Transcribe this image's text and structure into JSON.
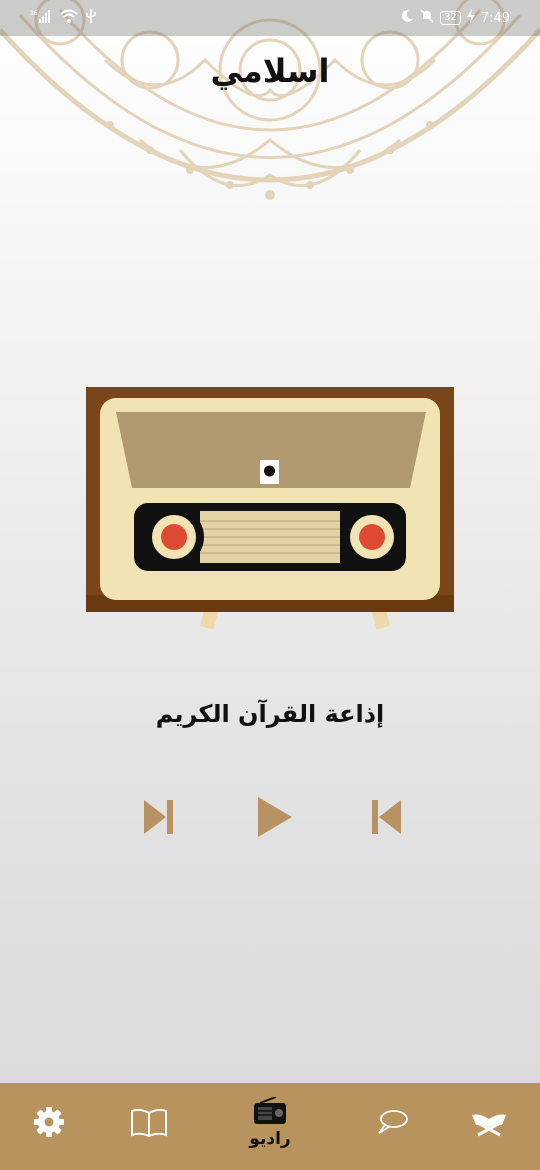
{
  "status_bar": {
    "network": "36",
    "battery": "32",
    "time": "7:49"
  },
  "app": {
    "title": "اسلامي"
  },
  "player": {
    "station_name": "إذاعة القرآن الكريم",
    "controls": [
      "next-icon",
      "play-icon",
      "previous-icon"
    ]
  },
  "bottom_nav": {
    "active_label": "راديو",
    "items": [
      "settings-icon",
      "book-icon",
      "radio-icon",
      "chat-icon",
      "quran-icon"
    ]
  },
  "colors": {
    "accent": "#b8935e",
    "control": "#b89262",
    "ornament": "#e2d2b6"
  }
}
